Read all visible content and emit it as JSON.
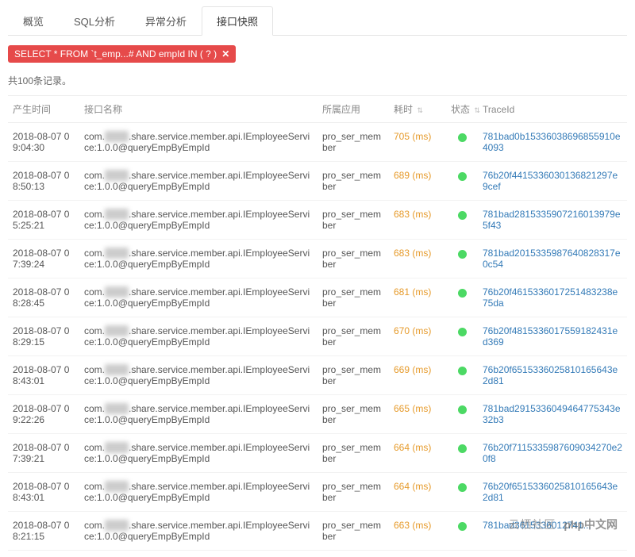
{
  "tabs": [
    {
      "label": "概览",
      "active": false
    },
    {
      "label": "SQL分析",
      "active": false
    },
    {
      "label": "异常分析",
      "active": false
    },
    {
      "label": "接口快照",
      "active": true
    }
  ],
  "filter_chip": {
    "text": "SELECT * FROM `t_emp...# AND empId IN ( ? )",
    "close": "✕"
  },
  "records_text": "共100条记录。",
  "columns": {
    "time": "产生时间",
    "name": "接口名称",
    "app": "所属应用",
    "duration": "耗时",
    "status": "状态",
    "trace": "TraceId",
    "sort": "⇅"
  },
  "interface_name_parts": {
    "prefix": "com.",
    "masked": "xxxxx",
    "suffix": ".share.service.member.api.IEmployeeService:1.0.0@queryEmpByEmpId"
  },
  "app_name": "pro_ser_member",
  "rows": [
    {
      "time": "2018-08-07 09:04:30",
      "duration": "705 (ms)",
      "trace": "781bad0b15336038696855910e4093"
    },
    {
      "time": "2018-08-07 08:50:13",
      "duration": "689 (ms)",
      "trace": "76b20f4415336030136821297e9cef"
    },
    {
      "time": "2018-08-07 05:25:21",
      "duration": "683 (ms)",
      "trace": "781bad2815335907216013979e5f43"
    },
    {
      "time": "2018-08-07 07:39:24",
      "duration": "683 (ms)",
      "trace": "781bad2015335987640828317e0c54"
    },
    {
      "time": "2018-08-07 08:28:45",
      "duration": "681 (ms)",
      "trace": "76b20f4615336017251483238e75da"
    },
    {
      "time": "2018-08-07 08:29:15",
      "duration": "670 (ms)",
      "trace": "76b20f4815336017559182431ed369"
    },
    {
      "time": "2018-08-07 08:43:01",
      "duration": "669 (ms)",
      "trace": "76b20f6515336025810165643e2d81"
    },
    {
      "time": "2018-08-07 09:22:26",
      "duration": "665 (ms)",
      "trace": "781bad2915336049464775343e32b3"
    },
    {
      "time": "2018-08-07 07:39:21",
      "duration": "664 (ms)",
      "trace": "76b20f7115335987609034270e20f8"
    },
    {
      "time": "2018-08-07 08:43:01",
      "duration": "664 (ms)",
      "trace": "76b20f6515336025810165643e2d81"
    },
    {
      "time": "2018-08-07 08:21:15",
      "duration": "663 (ms)",
      "trace": "781bad3615336012741..."
    }
  ],
  "watermark": {
    "left": "云栖社区",
    "right": "php中文网"
  }
}
